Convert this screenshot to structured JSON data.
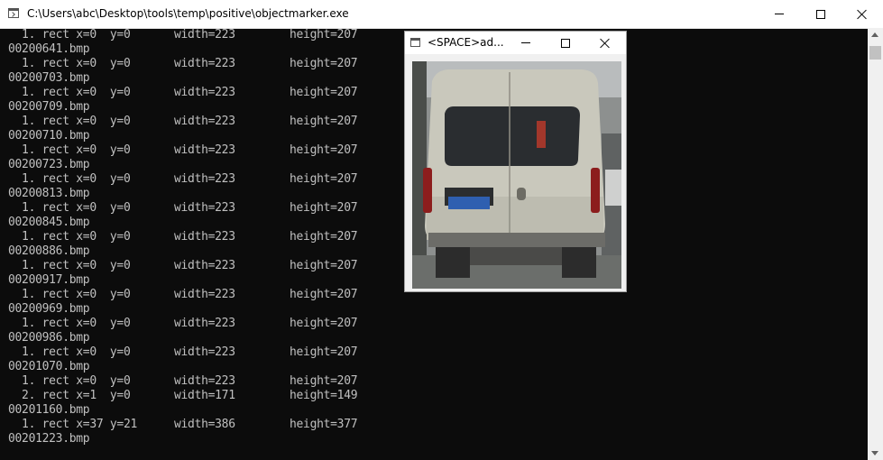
{
  "window": {
    "title": "C:\\Users\\abc\\Desktop\\tools\\temp\\positive\\objectmarker.exe",
    "icon": "console-app-icon"
  },
  "console": {
    "lines": [
      [
        "  1. rect x=0  y=0",
        "width=223",
        "height=207"
      ],
      [
        "00200641.bmp"
      ],
      [
        "  1. rect x=0  y=0",
        "width=223",
        "height=207"
      ],
      [
        "00200703.bmp"
      ],
      [
        "  1. rect x=0  y=0",
        "width=223",
        "height=207"
      ],
      [
        "00200709.bmp"
      ],
      [
        "  1. rect x=0  y=0",
        "width=223",
        "height=207"
      ],
      [
        "00200710.bmp"
      ],
      [
        "  1. rect x=0  y=0",
        "width=223",
        "height=207"
      ],
      [
        "00200723.bmp"
      ],
      [
        "  1. rect x=0  y=0",
        "width=223",
        "height=207"
      ],
      [
        "00200813.bmp"
      ],
      [
        "  1. rect x=0  y=0",
        "width=223",
        "height=207"
      ],
      [
        "00200845.bmp"
      ],
      [
        "  1. rect x=0  y=0",
        "width=223",
        "height=207"
      ],
      [
        "00200886.bmp"
      ],
      [
        "  1. rect x=0  y=0",
        "width=223",
        "height=207"
      ],
      [
        "00200917.bmp"
      ],
      [
        "  1. rect x=0  y=0",
        "width=223",
        "height=207"
      ],
      [
        "00200969.bmp"
      ],
      [
        "  1. rect x=0  y=0",
        "width=223",
        "height=207"
      ],
      [
        "00200986.bmp"
      ],
      [
        "  1. rect x=0  y=0",
        "width=223",
        "height=207"
      ],
      [
        "00201070.bmp"
      ],
      [
        "  1. rect x=0  y=0",
        "width=223",
        "height=207"
      ],
      [
        "  2. rect x=1  y=0",
        "width=171",
        "height=149"
      ],
      [
        "00201160.bmp"
      ],
      [
        "  1. rect x=37 y=21",
        "width=386",
        "height=377"
      ],
      [
        "00201223.bmp"
      ]
    ]
  },
  "viewer": {
    "title": "<SPACE>ad...",
    "image_subject": "rear view of a white van"
  },
  "colors": {
    "console_bg": "#0c0c0c",
    "console_text": "#c0c0c0",
    "titlebar_bg": "#ffffff"
  }
}
